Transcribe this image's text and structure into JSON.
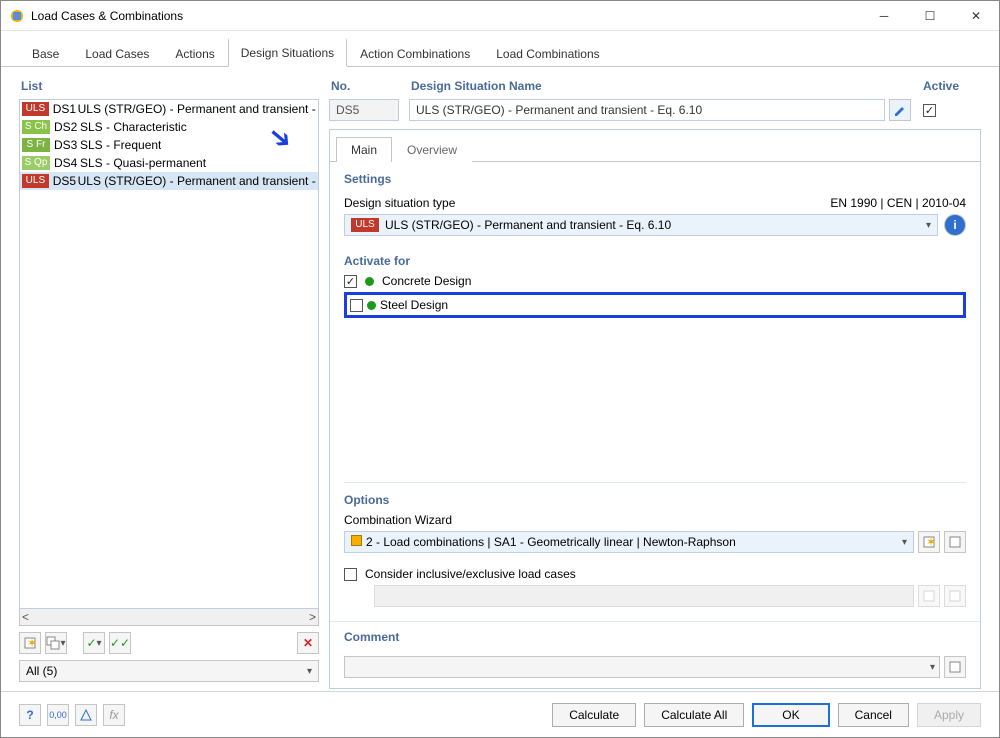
{
  "window": {
    "title": "Load Cases & Combinations"
  },
  "tabs": [
    "Base",
    "Load Cases",
    "Actions",
    "Design Situations",
    "Action Combinations",
    "Load Combinations"
  ],
  "activeTab": 3,
  "listHeader": "List",
  "list": [
    {
      "badge": "ULS",
      "badgeClass": "b-uls",
      "id": "DS1",
      "name": "ULS (STR/GEO) - Permanent and transient - E"
    },
    {
      "badge": "S Ch",
      "badgeClass": "b-sch",
      "id": "DS2",
      "name": "SLS - Characteristic"
    },
    {
      "badge": "S Fr",
      "badgeClass": "b-sfr",
      "id": "DS3",
      "name": "SLS - Frequent"
    },
    {
      "badge": "S Qp",
      "badgeClass": "b-sqp",
      "id": "DS4",
      "name": "SLS - Quasi-permanent"
    },
    {
      "badge": "ULS",
      "badgeClass": "b-uls",
      "id": "DS5",
      "name": "ULS (STR/GEO) - Permanent and transient - E"
    }
  ],
  "filter": "All (5)",
  "no": {
    "label": "No.",
    "value": "DS5"
  },
  "dsname": {
    "label": "Design Situation Name",
    "value": "ULS (STR/GEO) - Permanent and transient - Eq. 6.10"
  },
  "active": {
    "label": "Active",
    "checked": true
  },
  "subtabs": [
    "Main",
    "Overview"
  ],
  "settings": {
    "title": "Settings",
    "typeLabel": "Design situation type",
    "standard": "EN 1990 | CEN | 2010-04",
    "ddLabel": "ULS",
    "ddText": "ULS (STR/GEO) - Permanent and transient - Eq. 6.10"
  },
  "activate": {
    "title": "Activate for",
    "opts": [
      {
        "label": "Concrete Design",
        "checked": true
      },
      {
        "label": "Steel Design",
        "checked": false
      }
    ]
  },
  "options": {
    "title": "Options",
    "wizLabel": "Combination Wizard",
    "wizValue": "2 - Load combinations | SA1 - Geometrically linear | Newton-Raphson",
    "considerLabel": "Consider inclusive/exclusive load cases"
  },
  "comment": {
    "title": "Comment"
  },
  "footer": {
    "calculate": "Calculate",
    "calculateAll": "Calculate All",
    "ok": "OK",
    "cancel": "Cancel",
    "apply": "Apply"
  }
}
